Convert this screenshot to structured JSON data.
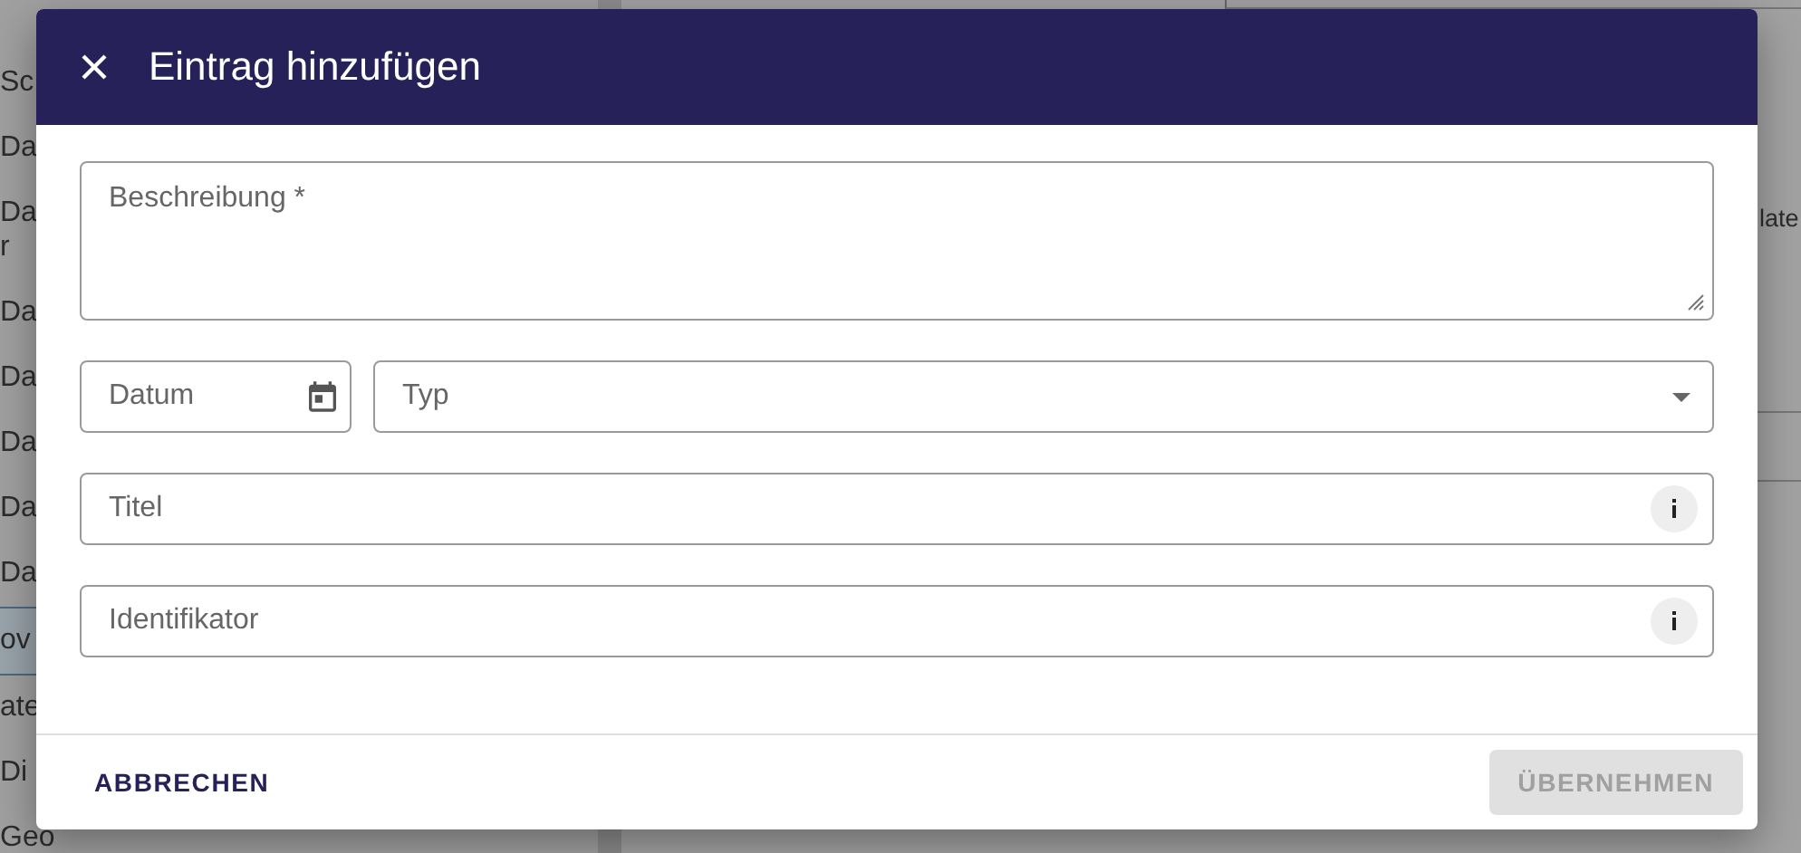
{
  "background": {
    "sidebar_items": [
      {
        "text": "Sc",
        "selected": false
      },
      {
        "text": "Da",
        "selected": false
      },
      {
        "text": "Da",
        "selected": false,
        "continuation": "r"
      },
      {
        "text": "Da",
        "selected": false
      },
      {
        "text": "Da",
        "selected": false
      },
      {
        "text": "Da",
        "selected": false
      },
      {
        "text": "Da",
        "selected": false
      },
      {
        "text": "Da",
        "selected": false
      },
      {
        "text": "ov",
        "selected": true
      },
      {
        "text": "ate",
        "selected": false
      },
      {
        "text": "Di",
        "selected": false
      },
      {
        "text": "Geo",
        "selected": false
      }
    ],
    "main_text": "late"
  },
  "dialog": {
    "title": "Eintrag hinzufügen",
    "fields": [
      {
        "kind": "textarea",
        "label": "Beschreibung *"
      },
      {
        "kind": "date",
        "label": "Datum"
      },
      {
        "kind": "select",
        "label": "Typ"
      },
      {
        "kind": "info",
        "label": "Titel"
      },
      {
        "kind": "info",
        "label": "Identifikator"
      }
    ],
    "buttons": [
      {
        "label": "ABBRECHEN",
        "disabled": false
      },
      {
        "label": "ÜBERNEHMEN",
        "disabled": true
      }
    ]
  }
}
